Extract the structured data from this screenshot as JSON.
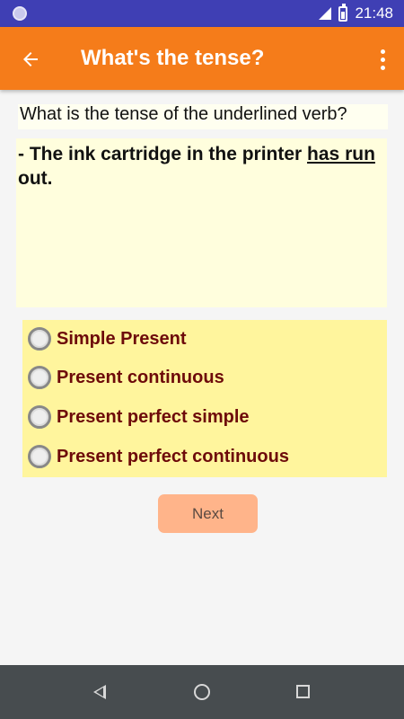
{
  "status_bar": {
    "time": "21:48",
    "icons": [
      "notification-icon",
      "signal-icon",
      "battery-icon"
    ]
  },
  "app_bar": {
    "title": "What's the tense?",
    "back_icon": "arrow-left-icon",
    "menu_icon": "more-vertical-icon",
    "color": "#f57c1a"
  },
  "question": {
    "prompt": "What is the tense of the underlined verb?",
    "sentence_before": "- The ink cartridge in the printer ",
    "sentence_verb": "has run",
    "sentence_after": " out."
  },
  "options": [
    {
      "label": "Simple Present",
      "selected": false
    },
    {
      "label": "Present continuous",
      "selected": false
    },
    {
      "label": "Present perfect simple",
      "selected": false
    },
    {
      "label": "Present perfect continuous",
      "selected": false
    }
  ],
  "next_button": {
    "label": "Next"
  },
  "nav_bar": {
    "icons": [
      "back-icon",
      "home-icon",
      "recents-icon"
    ]
  }
}
